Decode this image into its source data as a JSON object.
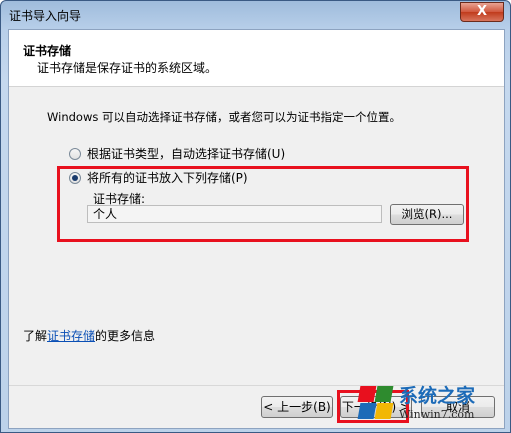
{
  "window": {
    "title": "证书导入向导",
    "close_label": "X"
  },
  "header": {
    "title": "证书存储",
    "subtitle": "证书存储是保存证书的系统区域。"
  },
  "intro": "Windows 可以自动选择证书存储，或者您可以为证书指定一个位置。",
  "options": [
    {
      "label": "根据证书类型，自动选择证书存储(U)",
      "checked": false
    },
    {
      "label": "将所有的证书放入下列存储(P)",
      "checked": true
    }
  ],
  "store": {
    "label": "证书存储:",
    "value": "个人",
    "browse_label": "浏览(R)..."
  },
  "more_info": {
    "prefix": "了解",
    "link": "证书存储",
    "suffix": "的更多信息"
  },
  "buttons": {
    "back": "< 上一步(B)",
    "next": "下一步(N) >",
    "cancel": "取消"
  },
  "watermark": {
    "main": "系统之家",
    "sub": "Winwin7.com"
  },
  "colors": {
    "highlight": "#e8101e",
    "link": "#0a4fb5",
    "titlebar": "#b9d0ea"
  }
}
